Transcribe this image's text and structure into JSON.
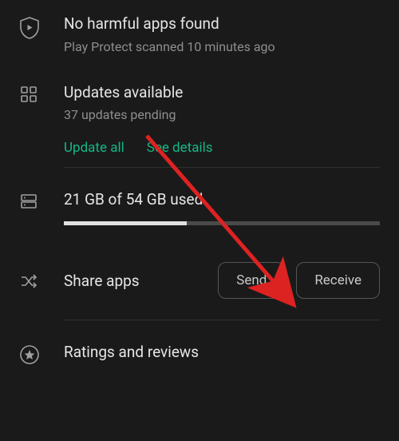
{
  "protect": {
    "title": "No harmful apps found",
    "subtitle": "Play Protect scanned 10 minutes ago"
  },
  "updates": {
    "title": "Updates available",
    "subtitle": "37 updates pending",
    "update_all": "Update all",
    "see_details": "See details"
  },
  "storage": {
    "text": "21 GB of 54 GB used",
    "used_gb": 21,
    "total_gb": 54
  },
  "share": {
    "title": "Share apps",
    "send": "Send",
    "receive": "Receive"
  },
  "ratings": {
    "title": "Ratings and reviews"
  },
  "colors": {
    "accent": "#16b785",
    "bg": "#1a1a1a"
  }
}
